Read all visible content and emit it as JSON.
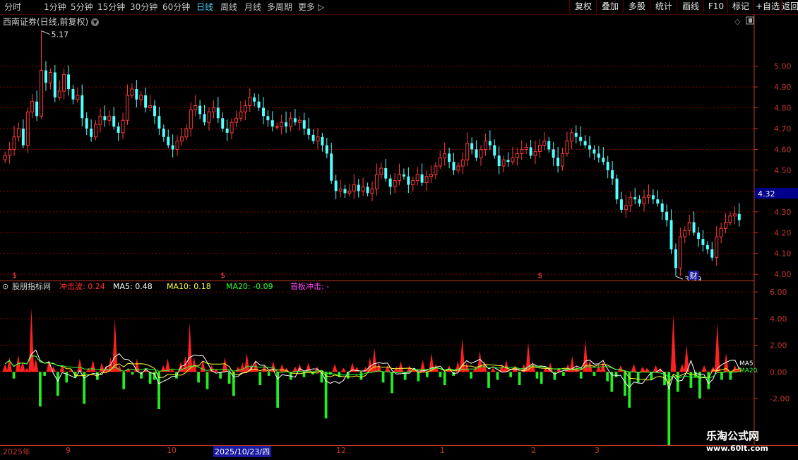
{
  "toolbar": {
    "periods": [
      "分时",
      "1分钟",
      "5分钟",
      "15分钟",
      "30分钟",
      "60分钟",
      "日线",
      "周线",
      "月线",
      "多周期",
      "更多"
    ],
    "active": "日线",
    "right_buttons": [
      "复权",
      "叠加",
      "多股",
      "统计",
      "画线",
      "F10",
      "标记",
      "+自选",
      "返回"
    ]
  },
  "main": {
    "title": "西南证券(日线,前复权)",
    "y_ticks": [
      "5.00",
      "4.90",
      "4.80",
      "4.70",
      "4.60",
      "4.50",
      "4.40",
      "4.30",
      "4.20",
      "4.10",
      "4.00"
    ],
    "current_price": "4.32",
    "high_label": "5.17",
    "low_label": "3.99",
    "event_marker": "财",
    "dividend_marker": "$"
  },
  "indicator": {
    "name": "股朋指标网",
    "legend": [
      {
        "label": "冲击波:",
        "value": "0.24",
        "color": "#ff3030"
      },
      {
        "label": "MA5:",
        "value": "0.48",
        "color": "#ffffff"
      },
      {
        "label": "MA10:",
        "value": "0.18",
        "color": "#ffff33"
      },
      {
        "label": "MA20:",
        "value": "-0.09",
        "color": "#33ff33"
      },
      {
        "label": "首板冲击:",
        "value": "-",
        "color": "#ff44ff"
      }
    ],
    "y_ticks": [
      "6.00",
      "4.00",
      "2.00",
      "0.00",
      "-2.00"
    ],
    "line_tags": [
      "MA5",
      "MA20"
    ]
  },
  "time_axis": {
    "labels": [
      "2025年",
      "9",
      "10",
      "12",
      "1",
      "2",
      "3"
    ],
    "cursor_date": "2025/10/23/四"
  },
  "watermark": {
    "title": "乐淘公式网",
    "url": "www.60lt.com"
  },
  "colors": {
    "up": "#ff3b3b",
    "down": "#54ffff",
    "grid": "#8b0000",
    "axis": "#c0392b"
  },
  "chart_data": {
    "type": "candlestick",
    "ylim": [
      3.97,
      5.25
    ],
    "closes": [
      4.57,
      4.6,
      4.66,
      4.7,
      4.62,
      4.78,
      4.83,
      4.76,
      4.98,
      4.92,
      4.97,
      4.85,
      4.88,
      4.96,
      4.89,
      4.84,
      4.86,
      4.75,
      4.7,
      4.66,
      4.72,
      4.76,
      4.74,
      4.76,
      4.71,
      4.68,
      4.74,
      4.86,
      4.89,
      4.84,
      4.86,
      4.8,
      4.81,
      4.76,
      4.7,
      4.66,
      4.62,
      4.6,
      4.64,
      4.66,
      4.7,
      4.79,
      4.81,
      4.77,
      4.73,
      4.78,
      4.8,
      4.75,
      4.7,
      4.68,
      4.73,
      4.75,
      4.78,
      4.81,
      4.85,
      4.83,
      4.8,
      4.76,
      4.74,
      4.71,
      4.71,
      4.73,
      4.71,
      4.75,
      4.73,
      4.74,
      4.7,
      4.67,
      4.64,
      4.66,
      4.62,
      4.58,
      4.45,
      4.4,
      4.41,
      4.39,
      4.4,
      4.43,
      4.4,
      4.42,
      4.39,
      4.41,
      4.48,
      4.51,
      4.46,
      4.42,
      4.45,
      4.48,
      4.47,
      4.43,
      4.45,
      4.48,
      4.44,
      4.47,
      4.48,
      4.52,
      4.56,
      4.58,
      4.54,
      4.5,
      4.52,
      4.55,
      4.63,
      4.6,
      4.56,
      4.6,
      4.64,
      4.62,
      4.57,
      4.52,
      4.55,
      4.54,
      4.56,
      4.58,
      4.6,
      4.61,
      4.57,
      4.59,
      4.62,
      4.64,
      4.6,
      4.56,
      4.52,
      4.58,
      4.64,
      4.68,
      4.66,
      4.64,
      4.62,
      4.6,
      4.58,
      4.56,
      4.54,
      4.5,
      4.46,
      4.36,
      4.31,
      4.33,
      4.37,
      4.36,
      4.34,
      4.37,
      4.38,
      4.36,
      4.34,
      4.3,
      4.26,
      4.12,
      4.03,
      4.18,
      4.21,
      4.25,
      4.2,
      4.17,
      4.14,
      4.12,
      4.08,
      4.18,
      4.22,
      4.25,
      4.28,
      4.29,
      4.26
    ],
    "events": {
      "high_index": 8,
      "low_index": 148,
      "dividend_indices": [
        2,
        48,
        118
      ],
      "earnings_index": 152
    }
  },
  "indicator_data": {
    "type": "bar",
    "ylim": [
      -5.5,
      6.8
    ],
    "values": [
      0.6,
      1.1,
      -0.5,
      1.3,
      0.8,
      0.3,
      4.8,
      1.0,
      -2.6,
      -0.3,
      0.9,
      0.4,
      -1.8,
      0.5,
      -0.8,
      0.2,
      -0.4,
      1.0,
      -2.4,
      0.3,
      0.9,
      -0.6,
      0.7,
      0.5,
      1.1,
      4.0,
      0.5,
      -1.3,
      0.3,
      -0.2,
      1.0,
      -0.5,
      0.3,
      -0.9,
      -0.6,
      -2.8,
      0.5,
      1.0,
      0.2,
      -0.5,
      0.8,
      1.2,
      3.7,
      1.1,
      -0.8,
      0.9,
      -1.3,
      0.5,
      0.2,
      -0.5,
      1.1,
      -0.9,
      -1.8,
      0.4,
      0.7,
      1.4,
      0.6,
      0.9,
      -1.0,
      0.5,
      -0.3,
      0.8,
      -2.7,
      0.6,
      0.3,
      -0.6,
      0.4,
      0.6,
      -0.4,
      0.7,
      -0.2,
      0.4,
      -0.8,
      -3.5,
      -0.2,
      0.6,
      -0.4,
      0.3,
      -0.5,
      0.7,
      0.4,
      -0.6,
      0.4,
      1.1,
      1.8,
      0.7,
      -0.8,
      0.5,
      -1.6,
      0.4,
      0.8,
      -0.6,
      0.5,
      0.3,
      -0.7,
      0.9,
      -0.4,
      1.4,
      0.6,
      -0.4,
      -1.0,
      0.5,
      -0.3,
      0.8,
      2.5,
      0.7,
      -0.5,
      0.4,
      1.6,
      0.8,
      -1.2,
      0.3,
      -0.6,
      0.6,
      0.9,
      -0.4,
      0.5,
      -1.0,
      0.6,
      2.2,
      0.8,
      -0.5,
      -0.9,
      0.4,
      0.7,
      -0.6,
      0.3,
      -0.3,
      0.6,
      1.2,
      0.4,
      -0.5,
      2.4,
      0.9,
      -0.3,
      0.5,
      0.8,
      -0.7,
      -1.5,
      -0.4,
      0.5,
      -1.8,
      -2.7,
      0.6,
      -0.8,
      0.4,
      0.3,
      -0.6,
      0.5,
      0.3,
      -1.0,
      -5.6,
      4.3,
      -1.5,
      0.6,
      2.0,
      -1.2,
      -0.4,
      -2.0,
      0.5,
      -1.3,
      0.4,
      3.7,
      -0.6,
      1.4,
      -0.6,
      0.5,
      0.4
    ]
  }
}
